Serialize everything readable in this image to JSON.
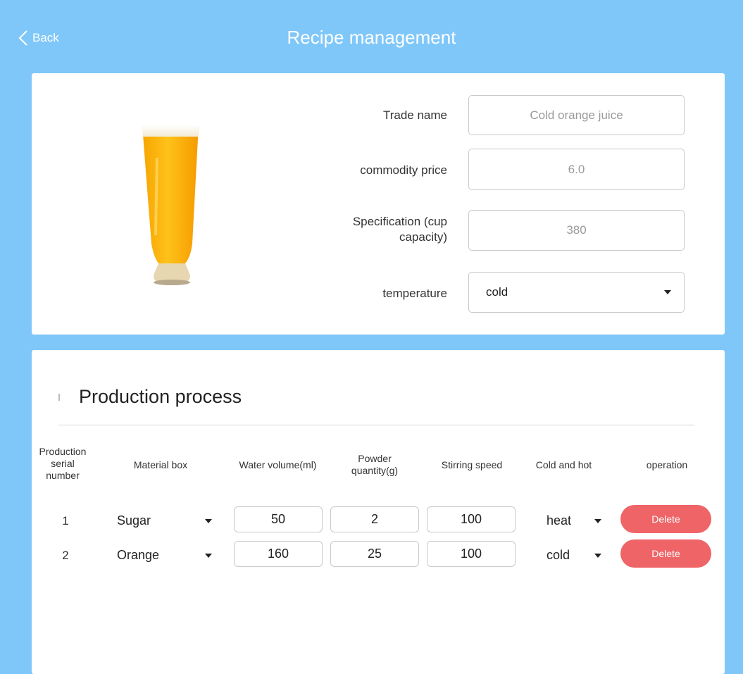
{
  "header": {
    "back_label": "Back",
    "title": "Recipe management"
  },
  "product": {
    "image_icon": "orange-juice-glass",
    "fields": {
      "trade_name_label": "Trade name",
      "trade_name_placeholder": "Cold orange juice",
      "price_label": "commodity price",
      "price_value": "6.0",
      "spec_label_line1": "Specification (cup",
      "spec_label_line2": "capacity)",
      "spec_value": "380",
      "temperature_label": "temperature",
      "temperature_value": "cold"
    }
  },
  "process": {
    "title": "Production process",
    "headers": {
      "serial_line1": "Production",
      "serial_line2": "serial",
      "serial_line3": "number",
      "material_box": "Material box",
      "water_volume": "Water volume(ml)",
      "powder_line1": "Powder",
      "powder_line2": "quantity(g)",
      "stirring_speed": "Stirring speed",
      "cold_and_hot": "Cold and hot",
      "operation": "operation"
    },
    "rows": [
      {
        "serial": "1",
        "material": "Sugar",
        "water": "50",
        "powder": "2",
        "speed": "100",
        "temp": "heat",
        "action": "Delete"
      },
      {
        "serial": "2",
        "material": "Orange",
        "water": "160",
        "powder": "25",
        "speed": "100",
        "temp": "cold",
        "action": "Delete"
      }
    ]
  },
  "colors": {
    "background": "#7fc7f9",
    "card": "#ffffff",
    "delete_button": "#ee6467"
  }
}
